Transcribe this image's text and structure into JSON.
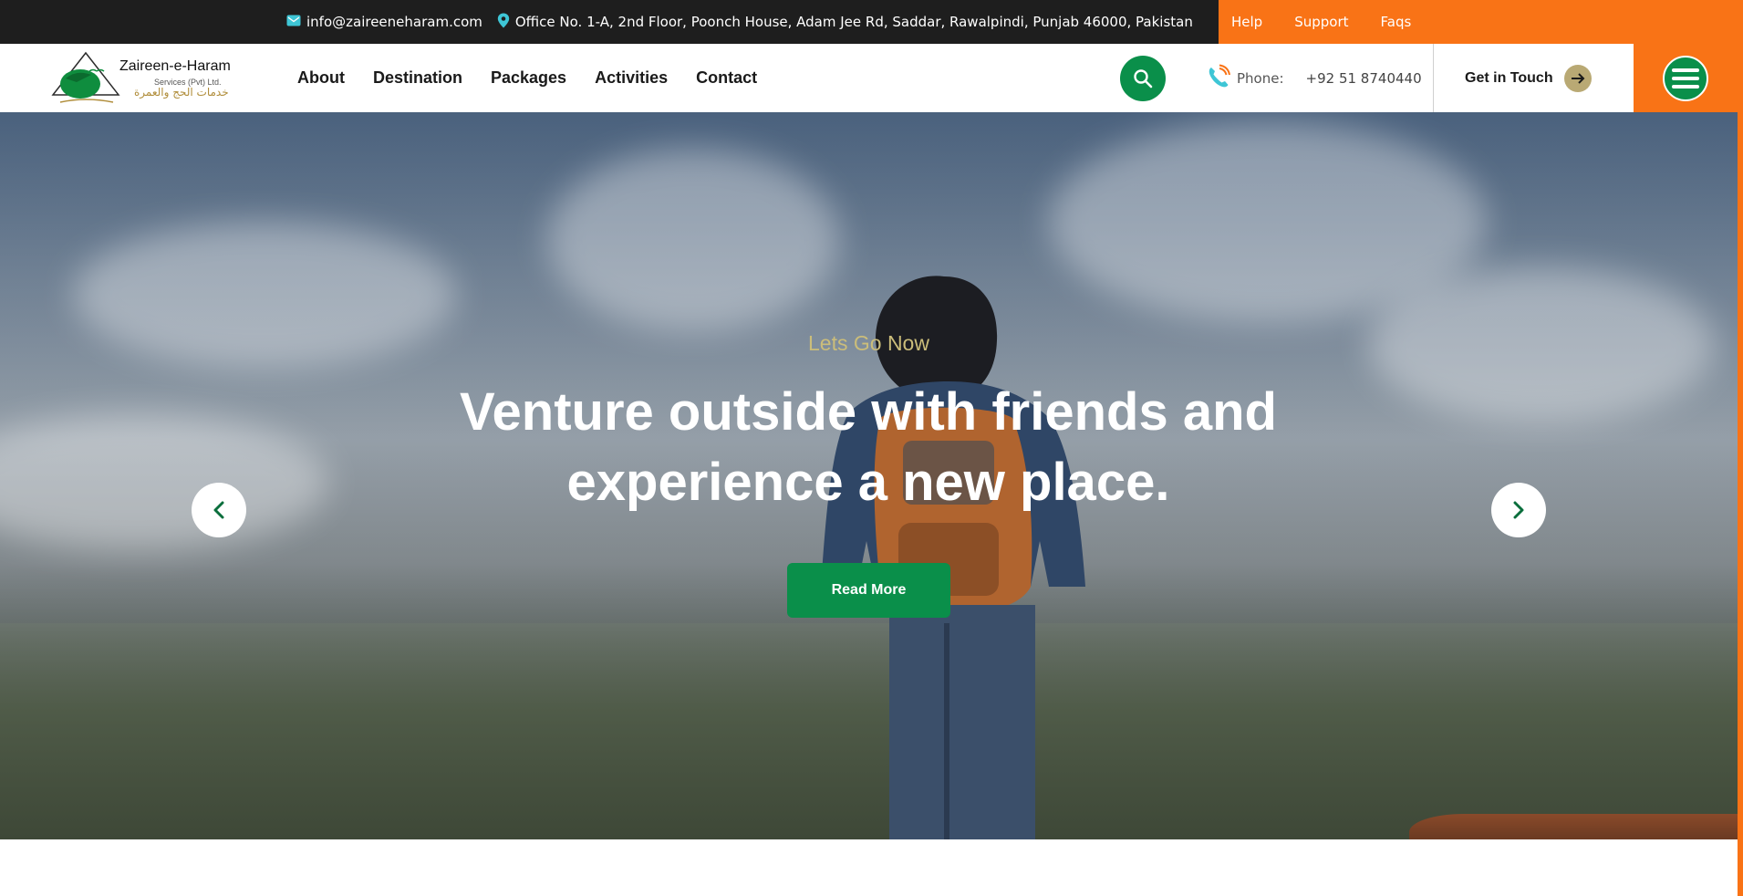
{
  "topbar": {
    "email": "info@zaireeneharam.com",
    "address": "Office No. 1-A, 2nd Floor, Poonch House, Adam Jee Rd, Saddar, Rawalpindi, Punjab 46000, Pakistan",
    "links": [
      "Help",
      "Support",
      "Faqs"
    ]
  },
  "logo": {
    "name": "Zaireen-e-Haram",
    "subtitle": "Services (Pvt) Ltd.",
    "arabic": "خدمات الحج والعمرة"
  },
  "nav": {
    "items": [
      "About",
      "Destination",
      "Packages",
      "Activities",
      "Contact"
    ]
  },
  "header": {
    "phone_label": "Phone:",
    "phone_number": "+92 51 8740440",
    "cta_label": "Get in Touch"
  },
  "hero": {
    "eyebrow": "Lets Go Now",
    "headline": "Venture outside with friends and experience a new place.",
    "button_label": "Read More"
  },
  "colors": {
    "accent_orange": "#f97316",
    "brand_green": "#0a8f4a",
    "eyebrow_gold": "#cbbd7a",
    "topbar_dark": "#1e1e1e"
  },
  "icons": [
    "mail-icon",
    "location-pin-icon",
    "search-icon",
    "phone-icon",
    "arrow-right-icon",
    "hamburger-menu-icon",
    "chevron-left-icon",
    "chevron-right-icon"
  ]
}
